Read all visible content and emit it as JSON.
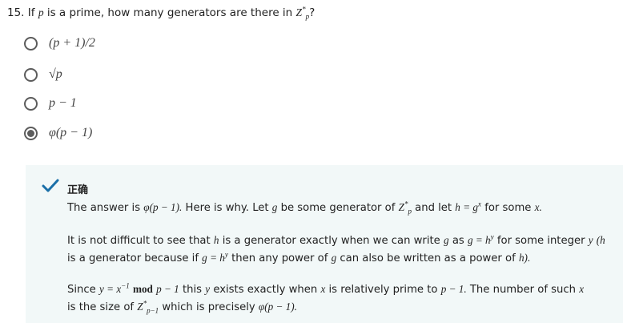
{
  "question": {
    "number": "15.",
    "pre": "If",
    "var_p": "p",
    "mid": "is a prime, how many generators are there in",
    "group": "Z",
    "sup": "*",
    "sub": "p",
    "end": "?"
  },
  "options": [
    {
      "text": "(p + 1)/2",
      "selected": false
    },
    {
      "text": "√p",
      "selected": false
    },
    {
      "text": "p − 1",
      "selected": false
    },
    {
      "text": "φ(p − 1)",
      "selected": true
    }
  ],
  "feedback": {
    "status_icon": "check-icon",
    "status_color": "#1a6fa8",
    "title": "正确",
    "line1": {
      "a": "The answer is",
      "m1": "φ(p − 1).",
      "b": "Here is why.  Let",
      "g": "g",
      "c": "be some generator of",
      "Z": "Z",
      "Zsup": "*",
      "Zsub": "p",
      "d": "and let",
      "eq": "h = g",
      "eqsup": "x",
      "e": "for some",
      "x": "x."
    },
    "line2": {
      "a": "It is not difficult to see that",
      "h": "h",
      "b": "is a generator exactly when we can write",
      "g": "g",
      "c": "as",
      "eq": "g = h",
      "eqsup": "y",
      "d": "for some integer",
      "y": "y",
      "e": "(h"
    },
    "line3": {
      "a": "is a generator because if",
      "eq": "g = h",
      "eqsup": "y",
      "b": "then any power of",
      "g": "g",
      "c": "can also be written as a power of",
      "h": "h)."
    },
    "line4": {
      "a": "Since",
      "eq": "y = x",
      "eqsup": "−1",
      "mod": "mod",
      "p1": "p − 1",
      "b": "this",
      "y": "y",
      "c": "exists exactly when",
      "x": "x",
      "d": "is relatively prime to",
      "p1b": "p − 1.",
      "e": "The number of such",
      "x2": "x"
    },
    "line5": {
      "a": "is the size of",
      "Z": "Z",
      "Zsup": "*",
      "Zsub": "p−1",
      "b": "which is precisely",
      "m": "φ(p − 1)."
    }
  }
}
